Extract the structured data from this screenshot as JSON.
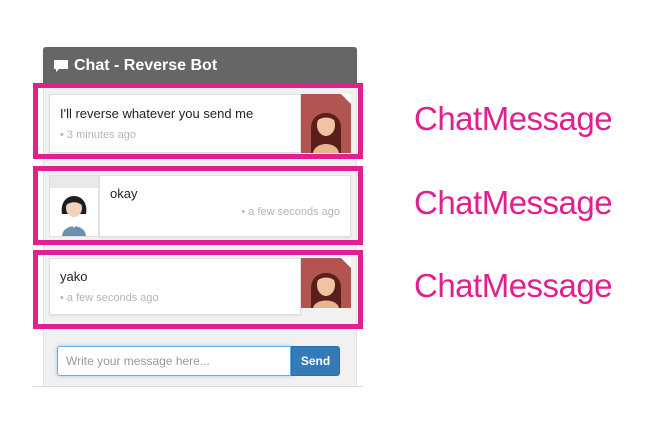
{
  "chat": {
    "title": "Chat - Reverse Bot",
    "icon": "speech-bubble-icon",
    "messages": [
      {
        "text": "I'll reverse whatever you send me",
        "time": "• 3 minutes ago",
        "sender": "bot",
        "avatar": "bot-avatar"
      },
      {
        "text": "okay",
        "time": "• a few seconds ago",
        "sender": "user",
        "avatar": "user-avatar"
      },
      {
        "text": "yako",
        "time": "• a few seconds ago",
        "sender": "bot",
        "avatar": "bot-avatar"
      }
    ],
    "input": {
      "placeholder": "Write your message here...",
      "value": ""
    },
    "send_label": "Send"
  },
  "annotations": {
    "labels": [
      "ChatMessage",
      "ChatMessage",
      "ChatMessage"
    ],
    "color": "#e0208e"
  },
  "colors": {
    "header_bg": "#666666",
    "send_button": "#337ab7",
    "highlight": "#e0208e"
  }
}
